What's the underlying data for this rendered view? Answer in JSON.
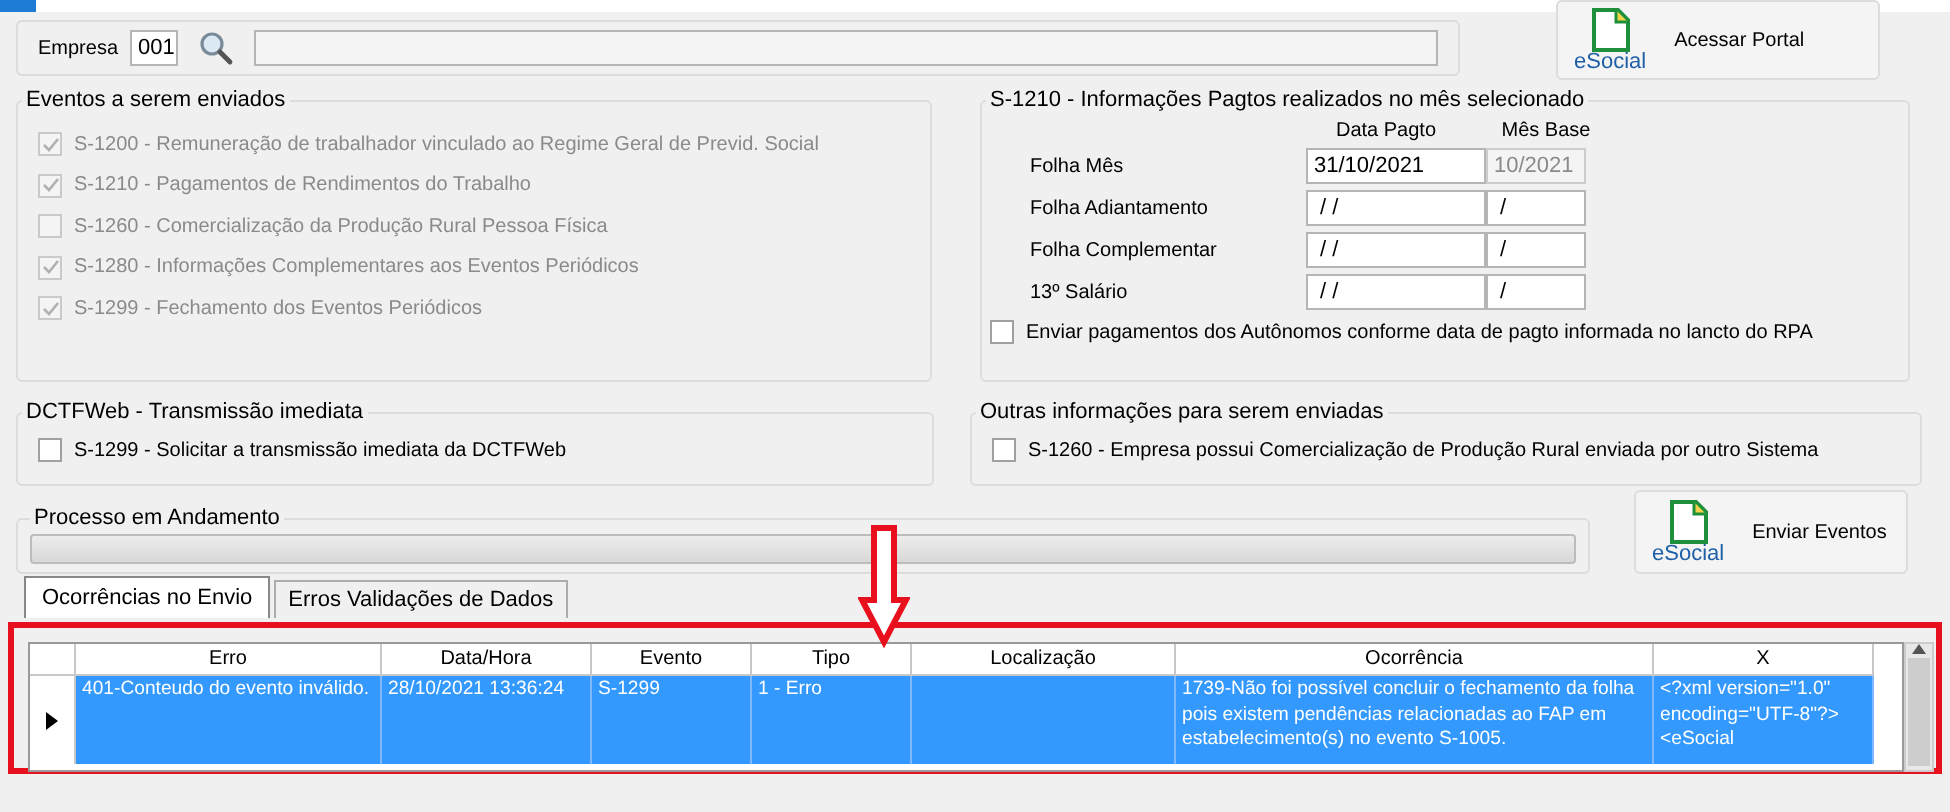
{
  "empresa": {
    "label": "Empresa",
    "code": "001"
  },
  "portal_button": {
    "label": "Acessar Portal",
    "logo_text": "eSocial"
  },
  "eventos": {
    "title": "Eventos a serem enviados",
    "disabled": true,
    "items": [
      {
        "label": "S-1200 - Remuneração de trabalhador vinculado ao Regime Geral de Previd. Social",
        "checked": true
      },
      {
        "label": "S-1210 - Pagamentos de Rendimentos do Trabalho",
        "checked": true
      },
      {
        "label": "S-1260 - Comercialização da Produção Rural Pessoa Física",
        "checked": false
      },
      {
        "label": "S-1280 - Informações Complementares aos Eventos Periódicos",
        "checked": true
      },
      {
        "label": "S-1299 - Fechamento dos Eventos Periódicos",
        "checked": true
      }
    ]
  },
  "pagtos": {
    "title": "S-1210 - Informações Pagtos realizados no mês selecionado",
    "columns": [
      "Data Pagto",
      "Mês Base"
    ],
    "rows": [
      {
        "label": "Folha Mês",
        "data_pagto": "31/10/2021",
        "mes_base": "10/2021",
        "mes_base_disabled": true
      },
      {
        "label": "Folha Adiantamento",
        "data_pagto": " / /",
        "mes_base": " /",
        "mes_base_disabled": false
      },
      {
        "label": "Folha Complementar",
        "data_pagto": " / /",
        "mes_base": " /",
        "mes_base_disabled": false
      },
      {
        "label": "13º Salário",
        "data_pagto": " / /",
        "mes_base": " /",
        "mes_base_disabled": false
      }
    ],
    "autonomos": {
      "label": "Enviar pagamentos dos Autônomos conforme data de pagto informada no lancto do RPA",
      "checked": false
    }
  },
  "dctfweb": {
    "title": "DCTFWeb - Transmissão imediata",
    "option": {
      "label": "S-1299 - Solicitar a transmissão imediata da DCTFWeb",
      "checked": false
    }
  },
  "outras": {
    "title": "Outras informações para serem enviadas",
    "option": {
      "label": "S-1260 - Empresa possui Comercialização de Produção Rural enviada por outro Sistema",
      "checked": false
    }
  },
  "processo": {
    "title": "Processo em Andamento",
    "level": 0
  },
  "enviar_button": {
    "label": "Enviar Eventos",
    "logo_text": "eSocial"
  },
  "tabs": [
    {
      "label": "Ocorrências no Envio",
      "selected": true
    },
    {
      "label": "Erros Validações de Dados",
      "selected": false
    }
  ],
  "table": {
    "columns": [
      "Erro",
      "Data/Hora",
      "Evento",
      "Tipo",
      "Localização",
      "Ocorrência",
      "X"
    ],
    "rows": [
      {
        "selected": true,
        "cells": [
          "401-Conteudo do evento inválido.",
          "28/10/2021 13:36:24",
          "S-1299",
          "1 - Erro",
          "",
          "1739-Não foi possível concluir o fechamento da folha pois existem pendências relacionadas ao FAP em estabelecimento(s) no evento S-1005.",
          "<?xml version=\"1.0\" encoding=\"UTF-8\"?><eSocial"
        ]
      }
    ]
  }
}
